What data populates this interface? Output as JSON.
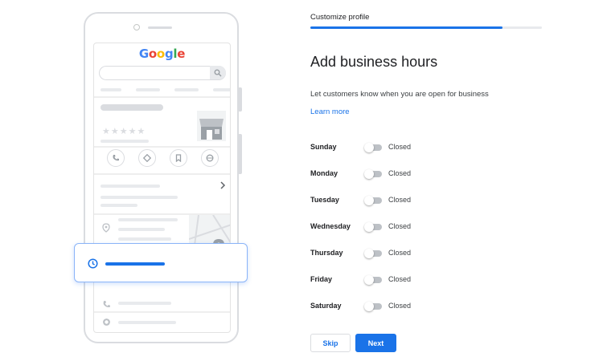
{
  "illustration": {
    "logo": [
      {
        "ch": "G",
        "cls": "g-b"
      },
      {
        "ch": "o",
        "cls": "g-r"
      },
      {
        "ch": "o",
        "cls": "g-y"
      },
      {
        "ch": "g",
        "cls": "g-b"
      },
      {
        "ch": "l",
        "cls": "g-g"
      },
      {
        "ch": "e",
        "cls": "g-r"
      }
    ],
    "rating_stars": 5
  },
  "colors": {
    "accent": "#1a73e8",
    "toggle_off": "#bdc1c6"
  },
  "header": {
    "step_label": "Customize profile",
    "progress": 0.83
  },
  "main": {
    "title": "Add business hours",
    "subtitle": "Let customers know when you are open for business",
    "learn_more": "Learn more"
  },
  "days": [
    {
      "name": "Sunday",
      "status": "Closed",
      "open": false
    },
    {
      "name": "Monday",
      "status": "Closed",
      "open": false
    },
    {
      "name": "Tuesday",
      "status": "Closed",
      "open": false
    },
    {
      "name": "Wednesday",
      "status": "Closed",
      "open": false
    },
    {
      "name": "Thursday",
      "status": "Closed",
      "open": false
    },
    {
      "name": "Friday",
      "status": "Closed",
      "open": false
    },
    {
      "name": "Saturday",
      "status": "Closed",
      "open": false
    }
  ],
  "actions": {
    "skip_label": "Skip",
    "next_label": "Next"
  }
}
